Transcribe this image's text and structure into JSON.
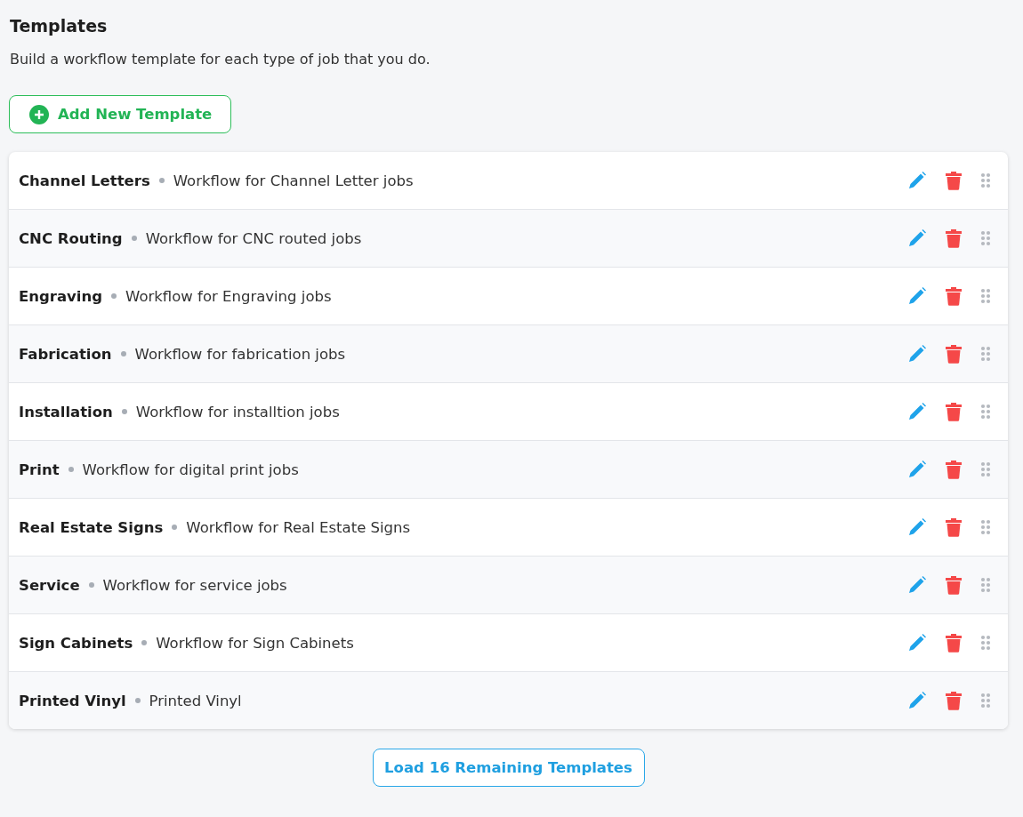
{
  "page": {
    "title": "Templates",
    "subtitle": "Build a workflow template for each type of job that you do."
  },
  "add_button": {
    "label": "Add New Template"
  },
  "templates": [
    {
      "name": "Channel Letters",
      "description": "Workflow for Channel Letter jobs"
    },
    {
      "name": "CNC Routing",
      "description": "Workflow for CNC routed jobs"
    },
    {
      "name": "Engraving",
      "description": "Workflow for Engraving jobs"
    },
    {
      "name": "Fabrication",
      "description": "Workflow for fabrication jobs"
    },
    {
      "name": "Installation",
      "description": "Workflow for installtion jobs"
    },
    {
      "name": "Print",
      "description": "Workflow for digital print jobs"
    },
    {
      "name": "Real Estate Signs",
      "description": "Workflow for Real Estate Signs"
    },
    {
      "name": "Service",
      "description": "Workflow for service jobs"
    },
    {
      "name": "Sign Cabinets",
      "description": "Workflow for Sign Cabinets"
    },
    {
      "name": "Printed Vinyl",
      "description": "Printed Vinyl"
    }
  ],
  "load_more_button": {
    "label": "Load 16 Remaining Templates"
  }
}
